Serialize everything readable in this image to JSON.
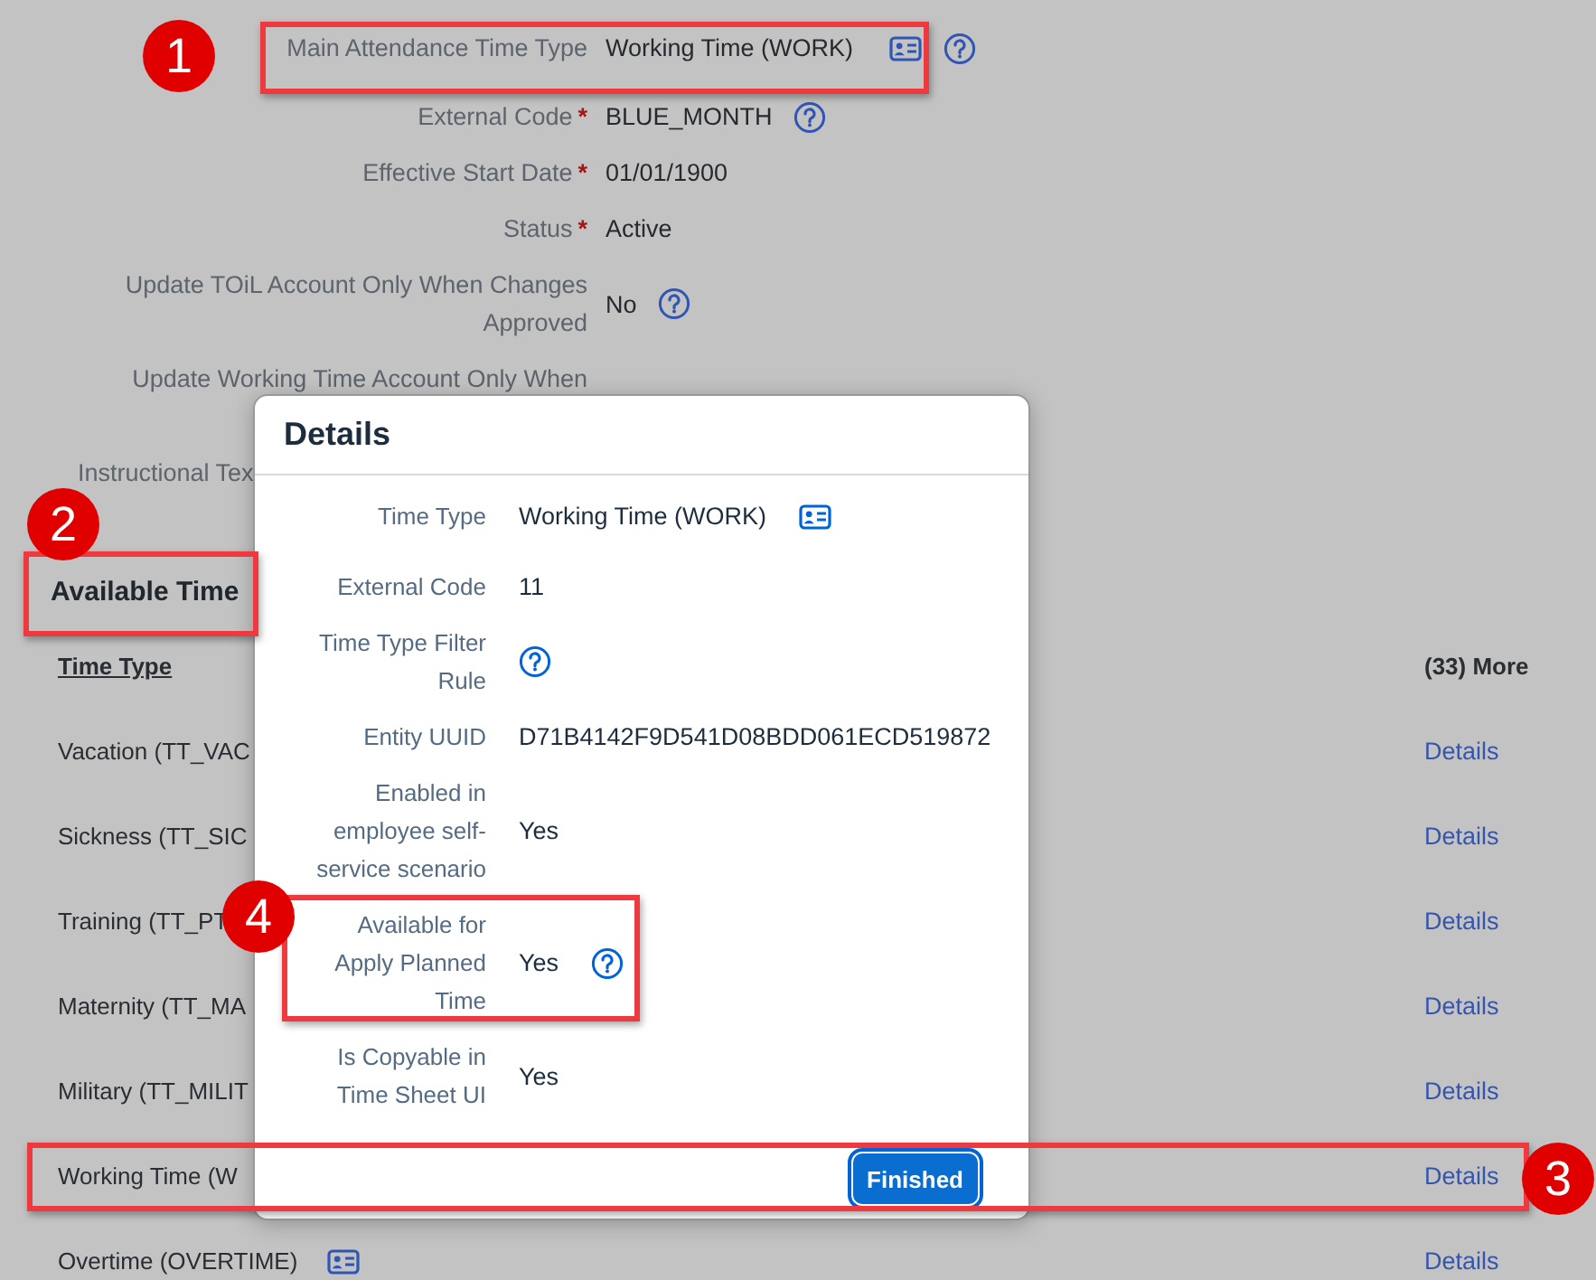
{
  "form_fields": [
    {
      "label": "Main Attendance Time Type",
      "value": "Working Time (WORK)",
      "card_icon": true,
      "help_icon": true
    },
    {
      "label": "External Code",
      "required_mark": "*",
      "value": "BLUE_MONTH",
      "help_icon": true
    },
    {
      "label": "Effective Start Date",
      "required_mark": "*",
      "value": "01/01/1900"
    },
    {
      "label": "Status",
      "required_mark": "*",
      "value": "Active"
    },
    {
      "label": "Update TOiL Account Only When Changes Approved",
      "value": "No",
      "help_icon": true
    },
    {
      "label": "Update Working Time Account Only When"
    },
    {
      "label": "Instructional Tex",
      "kind": "covered"
    }
  ],
  "available_time": {
    "title": "Available Time",
    "column_1": "Time Type",
    "more": "(33) More",
    "rows": [
      {
        "name": "Vacation (TT_VAC",
        "link": "Details"
      },
      {
        "name": "Sickness (TT_SIC",
        "link": "Details"
      },
      {
        "name": "Training (TT_PT",
        "link": "Details"
      },
      {
        "name": "Maternity (TT_MA",
        "link": "Details"
      },
      {
        "name": "Military (TT_MILIT",
        "link": "Details"
      },
      {
        "name": "Working Time (W",
        "link": "Details"
      },
      {
        "name": "Overtime (OVERTIME)",
        "card_icon": true,
        "link": "Details"
      }
    ]
  },
  "dialog": {
    "title": "Details",
    "fields": [
      {
        "label": "Time Type",
        "value": "Working Time (WORK)",
        "card_icon": true
      },
      {
        "label": "External Code",
        "value": "11"
      },
      {
        "label": "Time Type Filter Rule",
        "help_icon": true
      },
      {
        "label": "Entity UUID",
        "value": "D71B4142F9D541D08BDD061ECD519872"
      },
      {
        "label": "Enabled in employee self-service scenario",
        "value": "Yes"
      },
      {
        "label": "Available for Apply Planned Time",
        "value": "Yes",
        "help_icon": true
      },
      {
        "label": "Is Copyable in Time Sheet UI",
        "value": "Yes"
      }
    ],
    "button": "Finished"
  },
  "annotations": [
    {
      "number": "1"
    },
    {
      "number": "2"
    },
    {
      "number": "3"
    },
    {
      "number": "4"
    }
  ]
}
